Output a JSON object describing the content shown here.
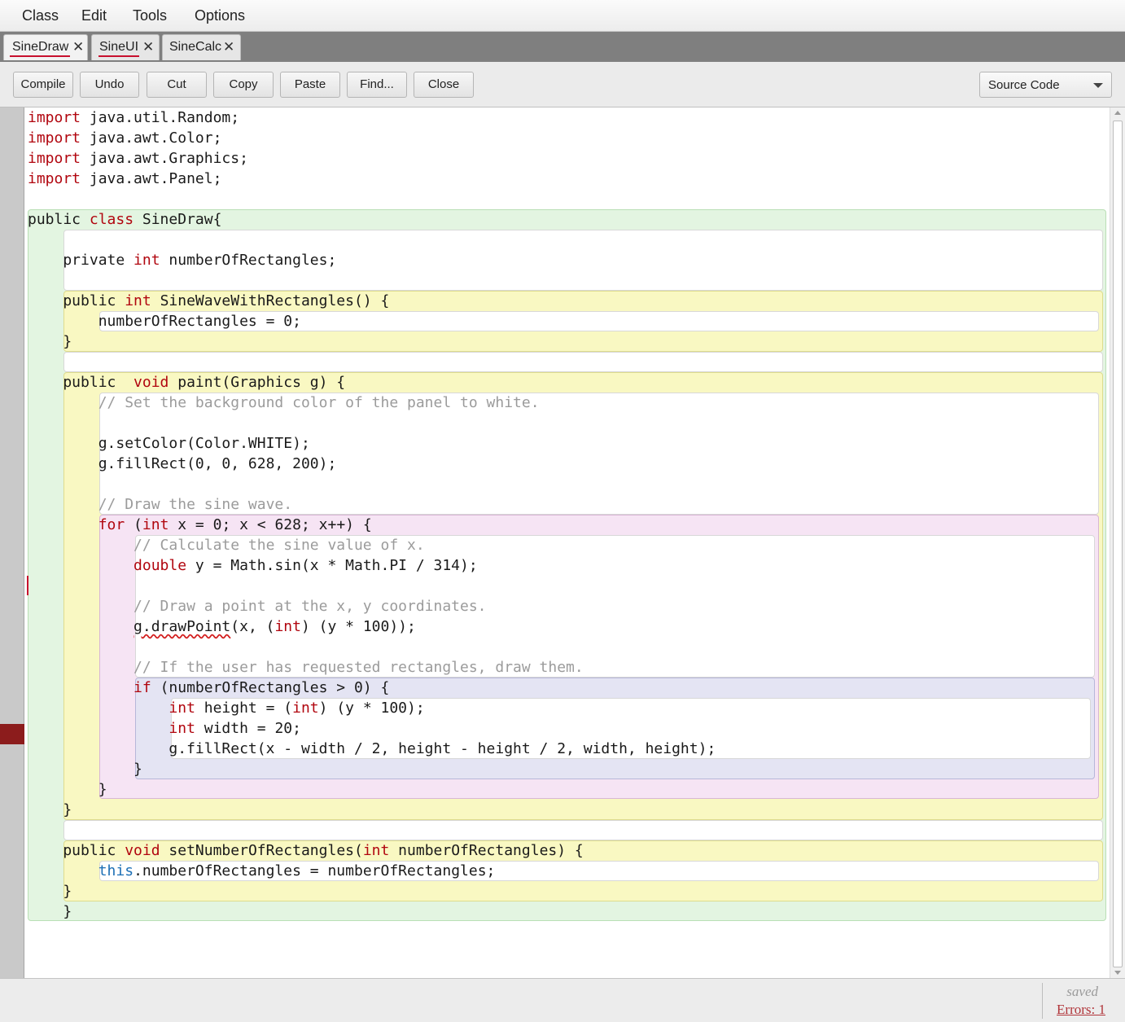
{
  "menu": {
    "items": [
      "Class",
      "Edit",
      "Tools",
      "Options"
    ]
  },
  "tabs": [
    {
      "label": "SineDraw",
      "active": true,
      "error": true
    },
    {
      "label": "SineUI",
      "active": false,
      "error": true
    },
    {
      "label": "SineCalc",
      "active": false,
      "error": false
    }
  ],
  "toolbar": {
    "buttons": [
      "Compile",
      "Undo",
      "Cut",
      "Copy",
      "Paste",
      "Find...",
      "Close"
    ],
    "view_selector": "Source Code"
  },
  "code_lines": [
    [
      [
        "import",
        "kw"
      ],
      [
        " java.util.Random;",
        ""
      ]
    ],
    [
      [
        "import",
        "kw"
      ],
      [
        " java.awt.Color;",
        ""
      ]
    ],
    [
      [
        "import",
        "kw"
      ],
      [
        " java.awt.Graphics;",
        ""
      ]
    ],
    [
      [
        "import",
        "kw"
      ],
      [
        " java.awt.Panel;",
        ""
      ]
    ],
    [],
    [
      [
        "public ",
        ""
      ],
      [
        "class",
        "kw"
      ],
      [
        " SineDraw{",
        ""
      ]
    ],
    [],
    [
      [
        "    private ",
        ""
      ],
      [
        "int",
        "kw"
      ],
      [
        " numberOfRectangles;",
        ""
      ]
    ],
    [],
    [
      [
        "    public ",
        ""
      ],
      [
        "int",
        "kw"
      ],
      [
        " SineWaveWithRectangles() {",
        ""
      ]
    ],
    [
      [
        "        numberOfRectangles = 0;",
        ""
      ]
    ],
    [
      [
        "    }",
        ""
      ]
    ],
    [],
    [
      [
        "    public  ",
        ""
      ],
      [
        "void",
        "kw"
      ],
      [
        " paint(Graphics g) {",
        ""
      ]
    ],
    [
      [
        "        // Set the background color of the panel to white.",
        "cm"
      ]
    ],
    [],
    [
      [
        "        g.setColor(Color.WHITE);",
        ""
      ]
    ],
    [
      [
        "        g.fillRect(0, 0, 628, 200);",
        ""
      ]
    ],
    [],
    [
      [
        "        // Draw the sine wave.",
        "cm"
      ]
    ],
    [
      [
        "        ",
        ""
      ],
      [
        "for",
        "kw"
      ],
      [
        " (",
        ""
      ],
      [
        "int",
        "kw"
      ],
      [
        " x = 0; x < 628; x++) {",
        ""
      ]
    ],
    [
      [
        "            // Calculate the sine value of x.",
        "cm"
      ]
    ],
    [
      [
        "            ",
        ""
      ],
      [
        "double",
        "kw"
      ],
      [
        " y = Math.sin(x * Math.PI / 314);",
        ""
      ]
    ],
    [],
    [
      [
        "            // Draw a point at the x, y coordinates.",
        "cm"
      ]
    ],
    [
      [
        "            ",
        ""
      ],
      [
        "g.drawPoint",
        "sq"
      ],
      [
        "(x, (",
        ""
      ],
      [
        "int",
        "kw"
      ],
      [
        ") (y * 100));",
        ""
      ]
    ],
    [],
    [
      [
        "            // If the user has requested rectangles, draw them.",
        "cm"
      ]
    ],
    [
      [
        "            ",
        ""
      ],
      [
        "if",
        "kw"
      ],
      [
        " (numberOfRectangles > 0) {",
        ""
      ]
    ],
    [
      [
        "                ",
        ""
      ],
      [
        "int",
        "kw"
      ],
      [
        " height = (",
        ""
      ],
      [
        "int",
        "kw"
      ],
      [
        ") (y * 100);",
        ""
      ]
    ],
    [
      [
        "                ",
        ""
      ],
      [
        "int",
        "kw"
      ],
      [
        " width = 20;",
        ""
      ]
    ],
    [
      [
        "                g.fillRect(x - width / 2, height - height / 2, width, height);",
        ""
      ]
    ],
    [
      [
        "            }",
        ""
      ]
    ],
    [
      [
        "        }",
        ""
      ]
    ],
    [
      [
        "    }",
        ""
      ]
    ],
    [],
    [
      [
        "    public ",
        ""
      ],
      [
        "void",
        "kw"
      ],
      [
        " setNumberOfRectangles(",
        ""
      ],
      [
        "int",
        "kw"
      ],
      [
        " numberOfRectangles) {",
        ""
      ]
    ],
    [
      [
        "        ",
        ""
      ],
      [
        "this",
        "kb"
      ],
      [
        ".numberOfRectangles = numberOfRectangles;",
        ""
      ]
    ],
    [
      [
        "    }",
        ""
      ]
    ],
    [
      [
        "    }",
        ""
      ]
    ]
  ],
  "status": {
    "saved": "saved",
    "errors": "Errors: 1"
  },
  "colors": {
    "keyword": "#b1060f",
    "this_keyword": "#1c6fb5",
    "comment": "#9b9b9b",
    "class_scope": "#e3f5e1",
    "method_scope": "#f9f8c2",
    "for_scope": "#f6e4f4",
    "if_scope": "#e4e4f3",
    "error": "#8c1c1c"
  }
}
